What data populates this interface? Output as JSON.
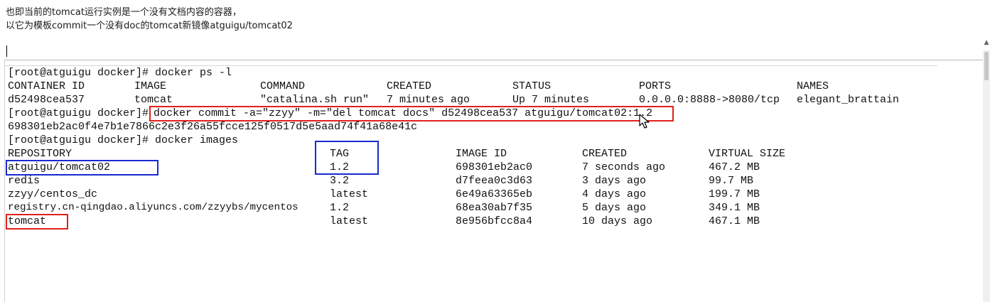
{
  "notes": {
    "line1": "也即当前的tomcat运行实例是一个没有文档内容的容器，",
    "line2": "以它为模板commit一个没有doc的tomcat新镜像atguigu/tomcat02"
  },
  "terminal": {
    "cmd_ps": "[root@atguigu docker]# docker ps -l",
    "ps_headers": [
      "CONTAINER ID",
      "IMAGE",
      "COMMAND",
      "CREATED",
      "STATUS",
      "PORTS",
      "NAMES"
    ],
    "ps_row": [
      "d52498cea537",
      "tomcat",
      "\"catalina.sh run\"",
      "7 minutes ago",
      "Up 7 minutes",
      "0.0.0.0:8888->8080/tcp",
      "elegant_brattain"
    ],
    "commit_prompt": "[root@atguigu docker]#",
    "commit_cmd": "docker commit -a=\"zzyy\" -m=\"del tomcat docs\" d52498cea537 atguigu/tomcat02:1.2",
    "commit_hash": "698301eb2ac0f4e7b1e7866c2e3f26a55fcce125f0517d5e5aad74f41a68e41c",
    "cmd_images": "[root@atguigu docker]# docker images",
    "images_headers": [
      "REPOSITORY",
      "TAG",
      "IMAGE ID",
      "CREATED",
      "VIRTUAL SIZE"
    ],
    "images_rows": [
      [
        "atguigu/tomcat02",
        "1.2",
        "698301eb2ac0",
        "7 seconds ago",
        "467.2 MB"
      ],
      [
        "redis",
        "3.2",
        "d7feea0c3d63",
        "3 days ago",
        "99.7 MB"
      ],
      [
        "zzyy/centos_dc",
        "latest",
        "6e49a63365eb",
        "4 days ago",
        "199.7 MB"
      ],
      [
        "registry.cn-qingdao.aliyuncs.com/zzyybs/mycentos",
        "1.2",
        "68ea30ab7f35",
        "5 days ago",
        "349.1 MB"
      ],
      [
        "tomcat",
        "latest",
        "8e956bfcc8a4",
        "10 days ago",
        "467.1 MB"
      ]
    ]
  },
  "colors": {
    "red_box": "#e0201a",
    "blue_box": "#1a2ad0"
  },
  "icons": {
    "pointer": "mouse-pointer-icon",
    "scroll_up": "scroll-up-arrow-icon"
  }
}
